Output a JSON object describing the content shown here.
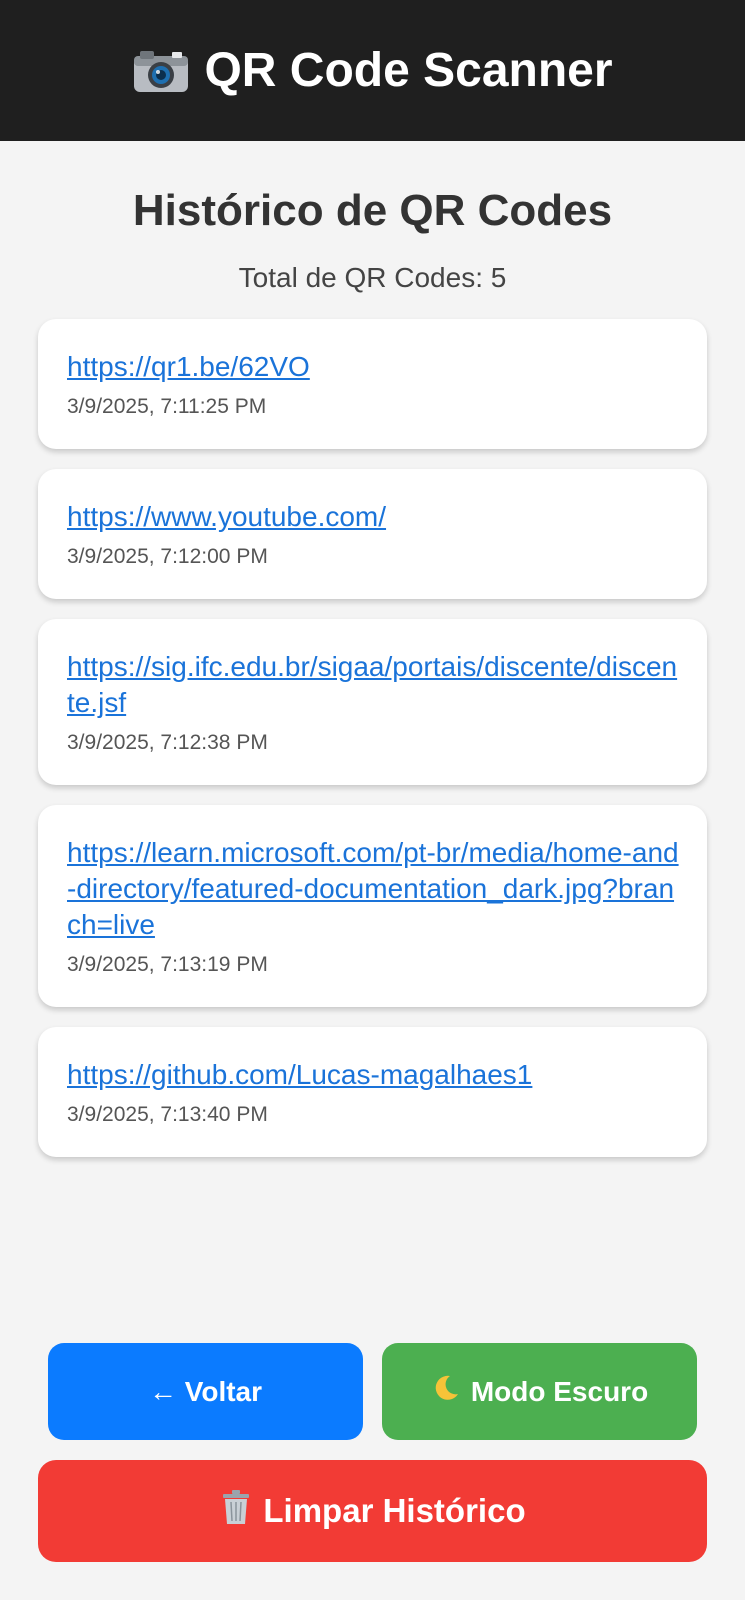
{
  "header": {
    "title": "QR Code Scanner",
    "icon": "camera-icon"
  },
  "page": {
    "title": "Histórico de QR Codes",
    "total_label": "Total de QR Codes: 5"
  },
  "history": [
    {
      "url": "https://qr1.be/62VO",
      "date": "3/9/2025, 7:11:25 PM"
    },
    {
      "url": "https://www.youtube.com/",
      "date": "3/9/2025, 7:12:00 PM"
    },
    {
      "url": "https://sig.ifc.edu.br/sigaa/portais/discente/discente.jsf",
      "date": "3/9/2025, 7:12:38 PM"
    },
    {
      "url": "https://learn.microsoft.com/pt-br/media/home-and-directory/featured-documentation_dark.jpg?branch=live",
      "date": "3/9/2025, 7:13:19 PM"
    },
    {
      "url": "https://github.com/Lucas-magalhaes1",
      "date": "3/9/2025, 7:13:40 PM"
    }
  ],
  "buttons": {
    "back_label": "← Voltar",
    "dark_mode_label": "Modo Escuro",
    "dark_mode_icon": "moon-icon",
    "clear_label": "Limpar Histórico",
    "clear_icon": "trash-icon"
  },
  "colors": {
    "header_bg": "#1f1f1f",
    "link": "#1a73d9",
    "back_button": "#0b7bff",
    "dark_mode_button": "#4caf50",
    "clear_button": "#f23b35"
  }
}
